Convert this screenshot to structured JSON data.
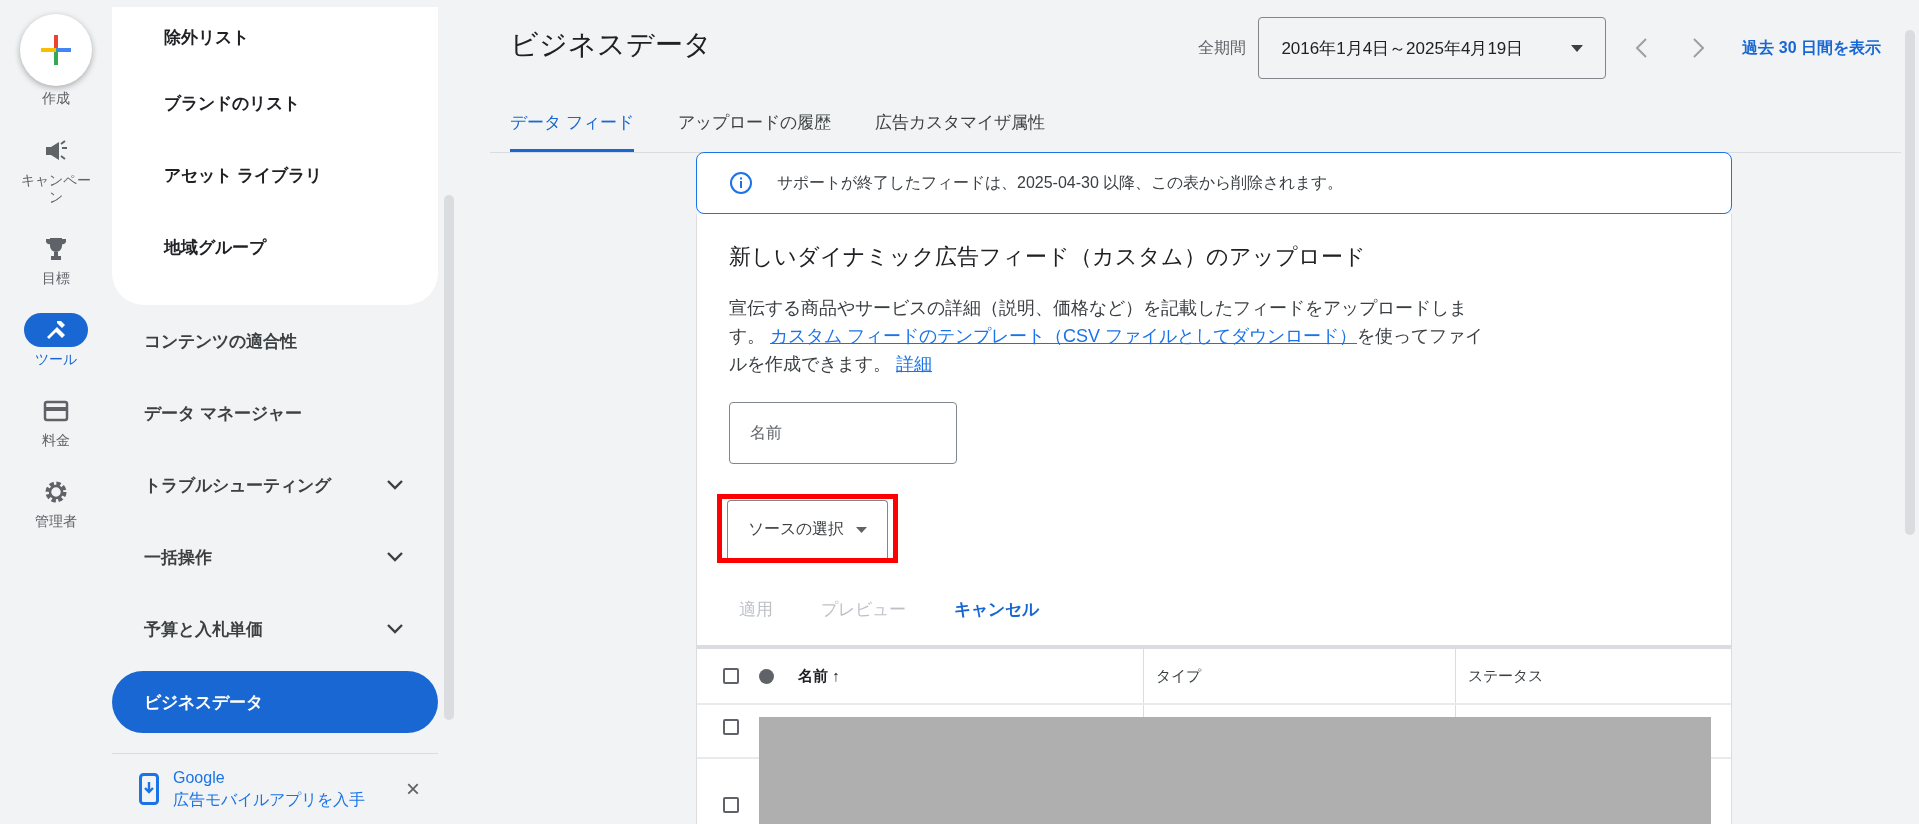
{
  "rail": {
    "create": {
      "label": "作成"
    },
    "items": [
      {
        "label": "キャンペーン",
        "selected": false
      },
      {
        "label": "目標",
        "selected": false
      },
      {
        "label": "ツール",
        "selected": true
      },
      {
        "label": "料金",
        "selected": false
      },
      {
        "label": "管理者",
        "selected": false
      }
    ]
  },
  "sidebar": {
    "submenu": [
      {
        "label": "除外リスト"
      },
      {
        "label": "ブランドのリスト"
      },
      {
        "label": "アセット ライブラリ"
      },
      {
        "label": "地域グループ"
      }
    ],
    "items": [
      {
        "label": "コンテンツの適合性",
        "kind": "plain",
        "selected": false
      },
      {
        "label": "データ マネージャー",
        "kind": "plain",
        "selected": false
      },
      {
        "label": "トラブルシューティング",
        "kind": "expandable",
        "selected": false
      },
      {
        "label": "一括操作",
        "kind": "expandable",
        "selected": false
      },
      {
        "label": "予算と入札単価",
        "kind": "expandable",
        "selected": false
      },
      {
        "label": "ビジネスデータ",
        "kind": "plain",
        "selected": true
      }
    ],
    "promo": {
      "title": "Google",
      "text": "広告モバイルアプリを入手",
      "close": "×"
    }
  },
  "header": {
    "title": "ビジネスデータ",
    "period_label": "全期間",
    "date_range": "2016年1月4日～2025年4月19日",
    "link": "過去 30 日間を表示"
  },
  "tabs": [
    {
      "label": "データ フィード",
      "selected": true
    },
    {
      "label": "アップロードの履歴",
      "selected": false
    },
    {
      "label": "広告カスタマイザ属性",
      "selected": false
    }
  ],
  "banner": {
    "text": "サポートが終了したフィードは、2025-04-30 以降、この表から削除されます。"
  },
  "upload": {
    "heading": "新しいダイナミック広告フィード（カスタム）のアップロード",
    "description": [
      {
        "kind": "text",
        "text": "宣伝する商品やサービスの詳細（説明、価格など）を記載したフィードをアップロードします。 "
      },
      {
        "kind": "link",
        "text": "カスタム フィードのテンプレート（CSV ファイルとしてダウンロード）"
      },
      {
        "kind": "text",
        "text": "を使ってファイルを作成できます。 "
      },
      {
        "kind": "link",
        "text": "詳細"
      }
    ],
    "name_field": {
      "placeholder": "名前"
    },
    "source_select": {
      "label": "ソースの選択",
      "highlighted": true
    },
    "actions": [
      {
        "label": "適用",
        "disabled": true
      },
      {
        "label": "プレビュー",
        "disabled": true
      },
      {
        "label": "キャンセル",
        "disabled": false
      }
    ]
  },
  "table": {
    "header_checked": false,
    "columns": [
      {
        "label": "名前",
        "sort": "↑"
      },
      {
        "label": "タイプ"
      },
      {
        "label": "ステータス"
      }
    ],
    "rows": [
      {
        "checked": false
      },
      {
        "checked": false
      }
    ],
    "redacted": true
  }
}
